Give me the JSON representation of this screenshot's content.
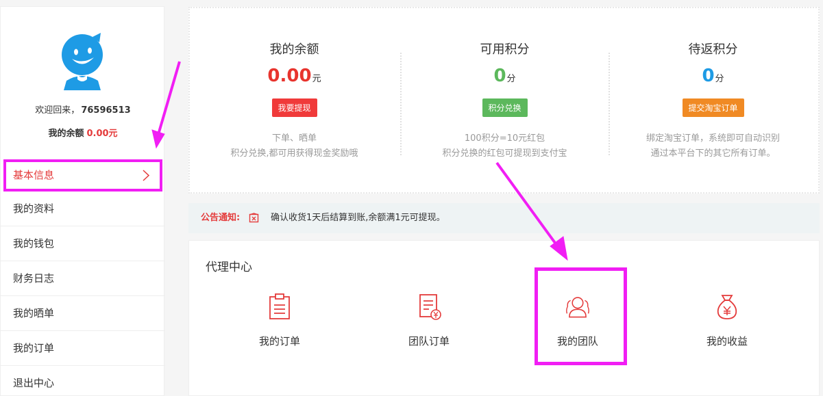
{
  "sidebar": {
    "welcome_prefix": "欢迎回来，",
    "user_id": "76596513",
    "balance_label": "我的余额",
    "balance_amount": "0.00元",
    "menu": [
      {
        "label": "基本信息",
        "icon": "chevron-right-icon"
      },
      {
        "label": "我的资料"
      },
      {
        "label": "我的钱包"
      },
      {
        "label": "财务日志"
      },
      {
        "label": "我的晒单"
      },
      {
        "label": "我的订单"
      },
      {
        "label": "退出中心"
      }
    ]
  },
  "stats": [
    {
      "title": "我的余额",
      "value": "0.00",
      "unit": "元",
      "value_color": "#e8342e",
      "button": "我要提现",
      "button_color": "#f03a3a",
      "desc1": "下单、晒单",
      "desc2": "积分兑换,都可用获得现金奖励哦"
    },
    {
      "title": "可用积分",
      "value": "0",
      "unit": "分",
      "value_color": "#5cb85c",
      "button": "积分兑换",
      "button_color": "#5cb85c",
      "desc1": "100积分=10元红包",
      "desc2": "积分兑换的红包可提现到支付宝"
    },
    {
      "title": "待返积分",
      "value": "0",
      "unit": "分",
      "value_color": "#1e9be5",
      "button": "提交淘宝订单",
      "button_color": "#f08a24",
      "desc1": "绑定淘宝订单，系统即可自动识别",
      "desc2": "通过本平台下的其它所有订单。"
    }
  ],
  "notice": {
    "label": "公告通知:",
    "icon": "notice-icon",
    "text": "确认收货1天后结算到账,余额满1元可提现。"
  },
  "agent": {
    "heading": "代理中心",
    "items": [
      {
        "label": "我的订单",
        "icon": "clipboard-icon"
      },
      {
        "label": "团队订单",
        "icon": "order-yen-icon"
      },
      {
        "label": "我的团队",
        "icon": "team-icon"
      },
      {
        "label": "我的收益",
        "icon": "money-bag-icon"
      }
    ]
  },
  "colors": {
    "accent_red": "#e43b3b",
    "annotation_magenta": "#f11ef4",
    "avatar_blue": "#1e9be5"
  }
}
